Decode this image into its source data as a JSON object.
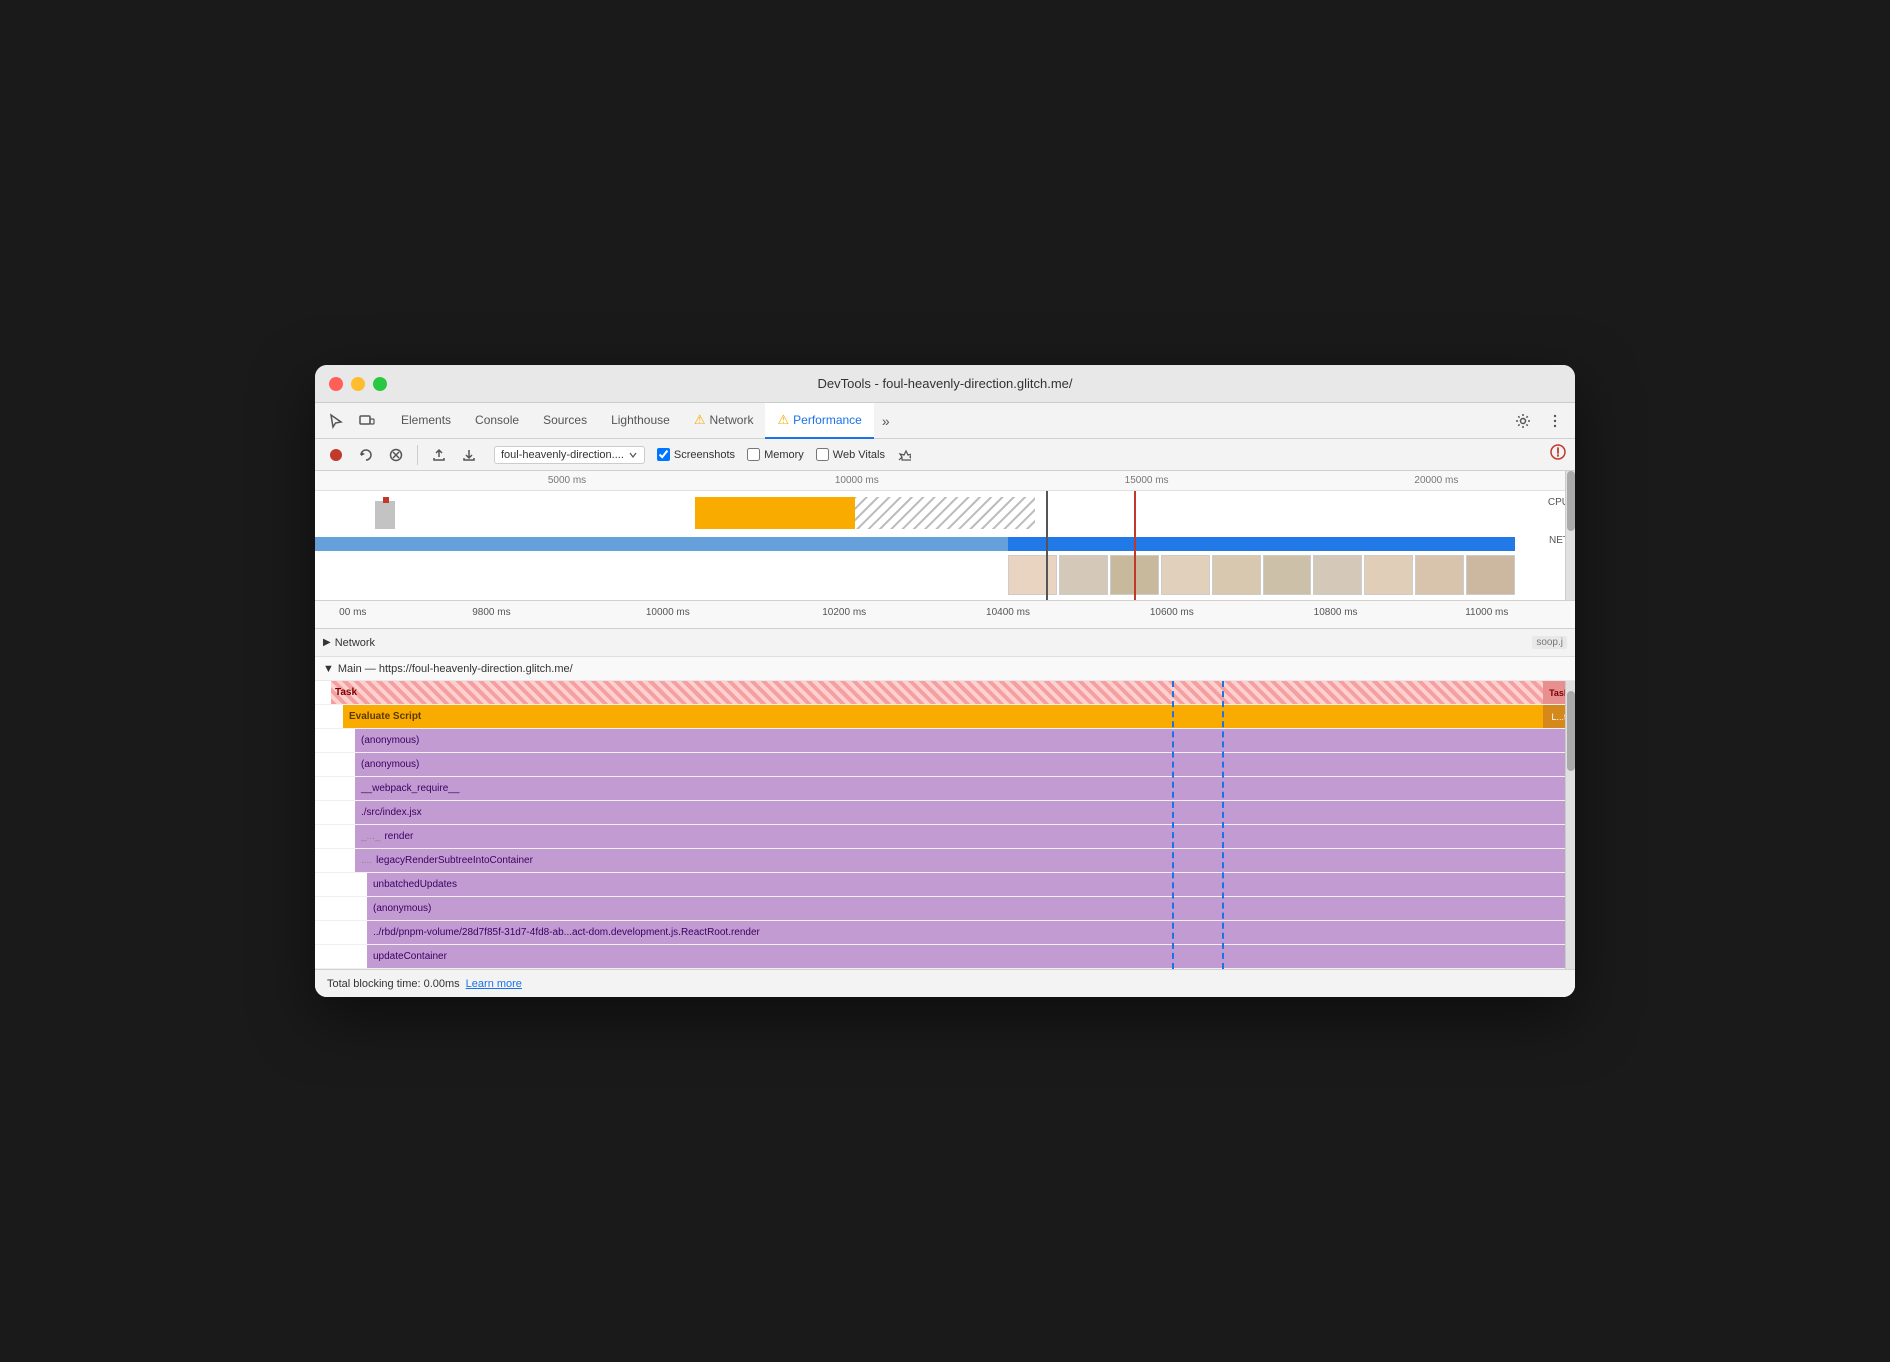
{
  "window": {
    "title": "DevTools - foul-heavenly-direction.glitch.me/"
  },
  "tabs": [
    {
      "id": "elements",
      "label": "Elements",
      "active": false,
      "warn": false
    },
    {
      "id": "console",
      "label": "Console",
      "active": false,
      "warn": false
    },
    {
      "id": "sources",
      "label": "Sources",
      "active": false,
      "warn": false
    },
    {
      "id": "lighthouse",
      "label": "Lighthouse",
      "active": false,
      "warn": false
    },
    {
      "id": "network",
      "label": "Network",
      "active": false,
      "warn": true
    },
    {
      "id": "performance",
      "label": "Performance",
      "active": true,
      "warn": true
    }
  ],
  "toolbar": {
    "url": "foul-heavenly-direction....",
    "screenshots_label": "Screenshots",
    "memory_label": "Memory",
    "web_vitals_label": "Web Vitals"
  },
  "timeline": {
    "overview_ticks": [
      "5000 ms",
      "10000 ms",
      "15000 ms",
      "20000 ms"
    ],
    "zoom_ticks": [
      "00 ms",
      "9800 ms",
      "10000 ms",
      "10200 ms",
      "10400 ms",
      "10600 ms",
      "10800 ms",
      "11000 ms"
    ],
    "cpu_label": "CPU",
    "net_label": "NET"
  },
  "tracks": {
    "network_label": "Network",
    "network_suffix": "soop.j",
    "main_label": "Main — https://foul-heavenly-direction.glitch.me/"
  },
  "flame": [
    {
      "id": "task",
      "label": "Task",
      "suffix": "Task",
      "type": "task-red",
      "indent": 0
    },
    {
      "id": "eval-script",
      "label": "Evaluate Script",
      "suffix": "L...t",
      "type": "task-yellow",
      "indent": 1
    },
    {
      "id": "anon1",
      "label": "(anonymous)",
      "type": "task-purple",
      "indent": 2
    },
    {
      "id": "anon2",
      "label": "(anonymous)",
      "type": "task-purple",
      "indent": 2
    },
    {
      "id": "webpack",
      "label": "__webpack_require__",
      "type": "task-purple",
      "indent": 2
    },
    {
      "id": "src-index",
      "label": "./src/index.jsx",
      "type": "task-purple",
      "indent": 2
    },
    {
      "id": "render",
      "label": "render",
      "type": "task-purple",
      "indent": 3
    },
    {
      "id": "legacy-render",
      "label": "legacyRenderSubtreeIntoContainer",
      "type": "task-purple",
      "indent": 3
    },
    {
      "id": "unbatched",
      "label": "unbatchedUpdates",
      "type": "task-purple",
      "indent": 4
    },
    {
      "id": "anon3",
      "label": "(anonymous)",
      "type": "task-purple",
      "indent": 4
    },
    {
      "id": "rbd",
      "label": "../rbd/pnpm-volume/28d7f85f-31d7-4fd8-ab...act-dom.development.js.ReactRoot.render",
      "type": "task-purple",
      "indent": 4
    },
    {
      "id": "update-container",
      "label": "updateContainer",
      "type": "task-purple",
      "indent": 4
    }
  ],
  "status": {
    "blocking_time": "Total blocking time: 0.00ms",
    "learn_more": "Learn more"
  }
}
